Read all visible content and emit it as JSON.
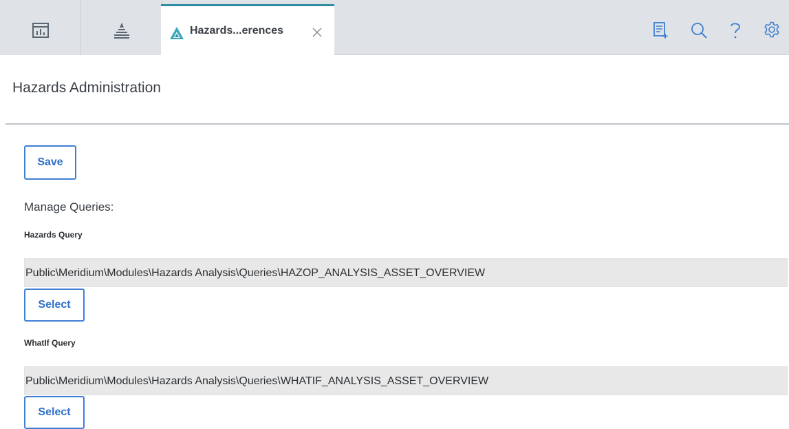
{
  "tabs": {
    "icon_tabs": [
      {
        "icon": "dashboard-icon"
      },
      {
        "icon": "asset-hierarchy-icon"
      }
    ],
    "active": {
      "icon": "hazards-icon",
      "label": "Hazards...erences",
      "accent_color": "#2e8fa3"
    }
  },
  "toolbar": {
    "icons": [
      "new-record-icon",
      "search-icon",
      "help-icon",
      "settings-icon"
    ]
  },
  "page": {
    "title": "Hazards Administration"
  },
  "actions": {
    "save_label": "Save"
  },
  "manage_queries": {
    "heading": "Manage Queries:",
    "hazards_query": {
      "label": "Hazards Query",
      "value": "Public\\Meridium\\Modules\\Hazards Analysis\\Queries\\HAZOP_ANALYSIS_ASSET_OVERVIEW",
      "select_label": "Select"
    },
    "whatif_query": {
      "label": "WhatIf Query",
      "value": "Public\\Meridium\\Modules\\Hazards Analysis\\Queries\\WHATIF_ANALYSIS_ASSET_OVERVIEW",
      "select_label": "Select"
    }
  },
  "colors": {
    "tabbar_bg": "#dfe3e8",
    "button_blue": "#2f6fc9",
    "field_bg": "#e8e8e8"
  }
}
